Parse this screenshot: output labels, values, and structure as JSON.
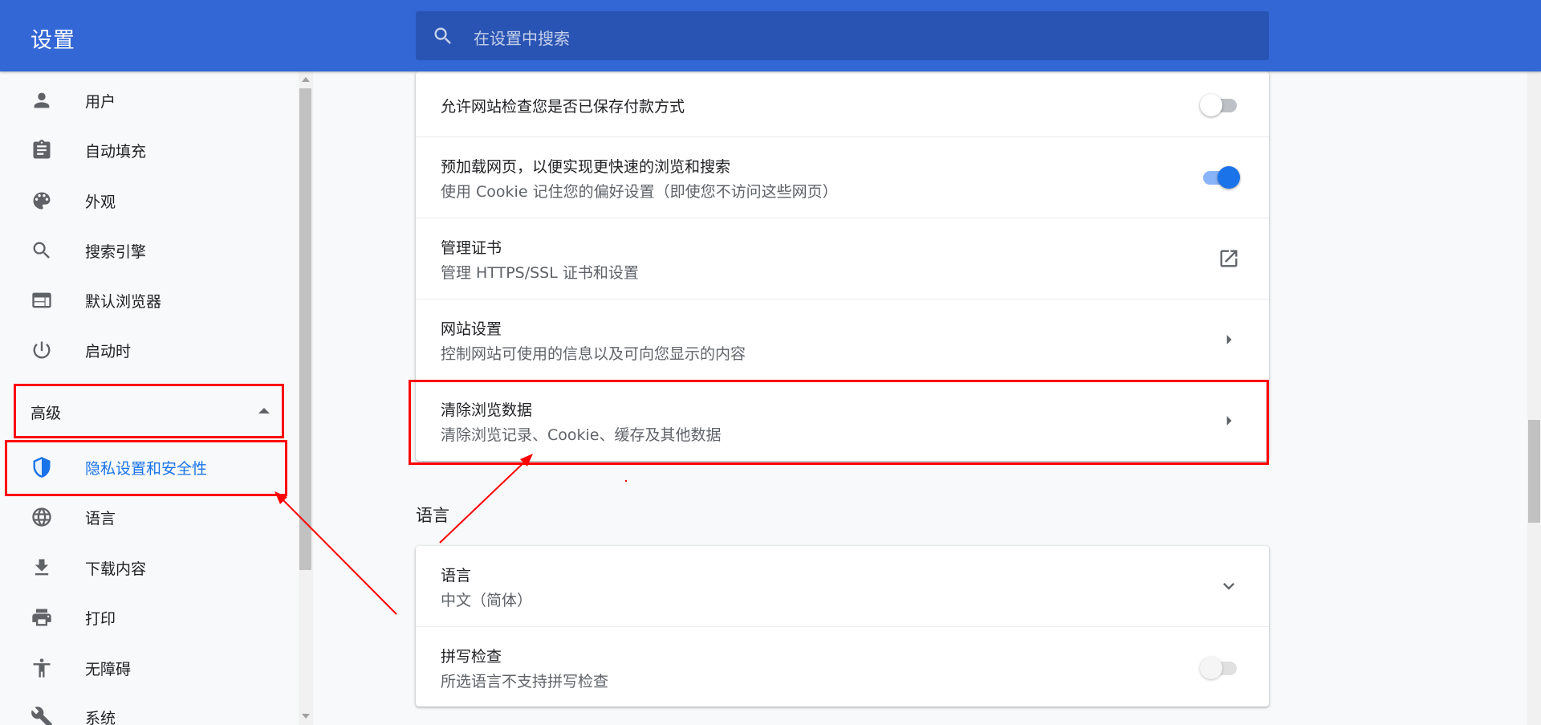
{
  "header": {
    "title": "设置",
    "search_placeholder": "在设置中搜索"
  },
  "sidebar": {
    "items": [
      {
        "label": "用户",
        "icon": "person-icon"
      },
      {
        "label": "自动填充",
        "icon": "clipboard-icon"
      },
      {
        "label": "外观",
        "icon": "palette-icon"
      },
      {
        "label": "搜索引擎",
        "icon": "search-icon"
      },
      {
        "label": "默认浏览器",
        "icon": "browser-window-icon"
      },
      {
        "label": "启动时",
        "icon": "power-icon"
      }
    ],
    "advanced_label": "高级",
    "advanced_items": [
      {
        "label": "隐私设置和安全性",
        "icon": "shield-icon",
        "active": true
      },
      {
        "label": "语言",
        "icon": "globe-icon"
      },
      {
        "label": "下载内容",
        "icon": "download-icon"
      },
      {
        "label": "打印",
        "icon": "printer-icon"
      },
      {
        "label": "无障碍",
        "icon": "accessibility-icon"
      },
      {
        "label": "系统",
        "icon": "wrench-icon"
      }
    ]
  },
  "privacy_card": {
    "rows": [
      {
        "title": "允许网站检查您是否已保存付款方式",
        "control": "toggle",
        "state": "off"
      },
      {
        "title": "预加载网页，以便实现更快速的浏览和搜索",
        "subtitle": "使用 Cookie 记住您的偏好设置（即使您不访问这些网页）",
        "control": "toggle",
        "state": "on"
      },
      {
        "title": "管理证书",
        "subtitle": "管理 HTTPS/SSL 证书和设置",
        "control": "external-link-icon"
      },
      {
        "title": "网站设置",
        "subtitle": "控制网站可使用的信息以及可向您显示的内容",
        "control": "arrow-right-icon"
      },
      {
        "title": "清除浏览数据",
        "subtitle": "清除浏览记录、Cookie、缓存及其他数据",
        "control": "arrow-right-icon"
      }
    ]
  },
  "language_section": {
    "title": "语言",
    "rows": [
      {
        "title": "语言",
        "subtitle": "中文（简体）",
        "control": "chevron-down-icon"
      },
      {
        "title": "拼写检查",
        "subtitle": "所选语言不支持拼写检查",
        "control": "toggle",
        "state": "disabled-off"
      }
    ]
  },
  "colors": {
    "header_bg": "#3367d6",
    "search_bg": "#2a54b3",
    "accent": "#1a73e8",
    "annotation": "#ff0000"
  }
}
